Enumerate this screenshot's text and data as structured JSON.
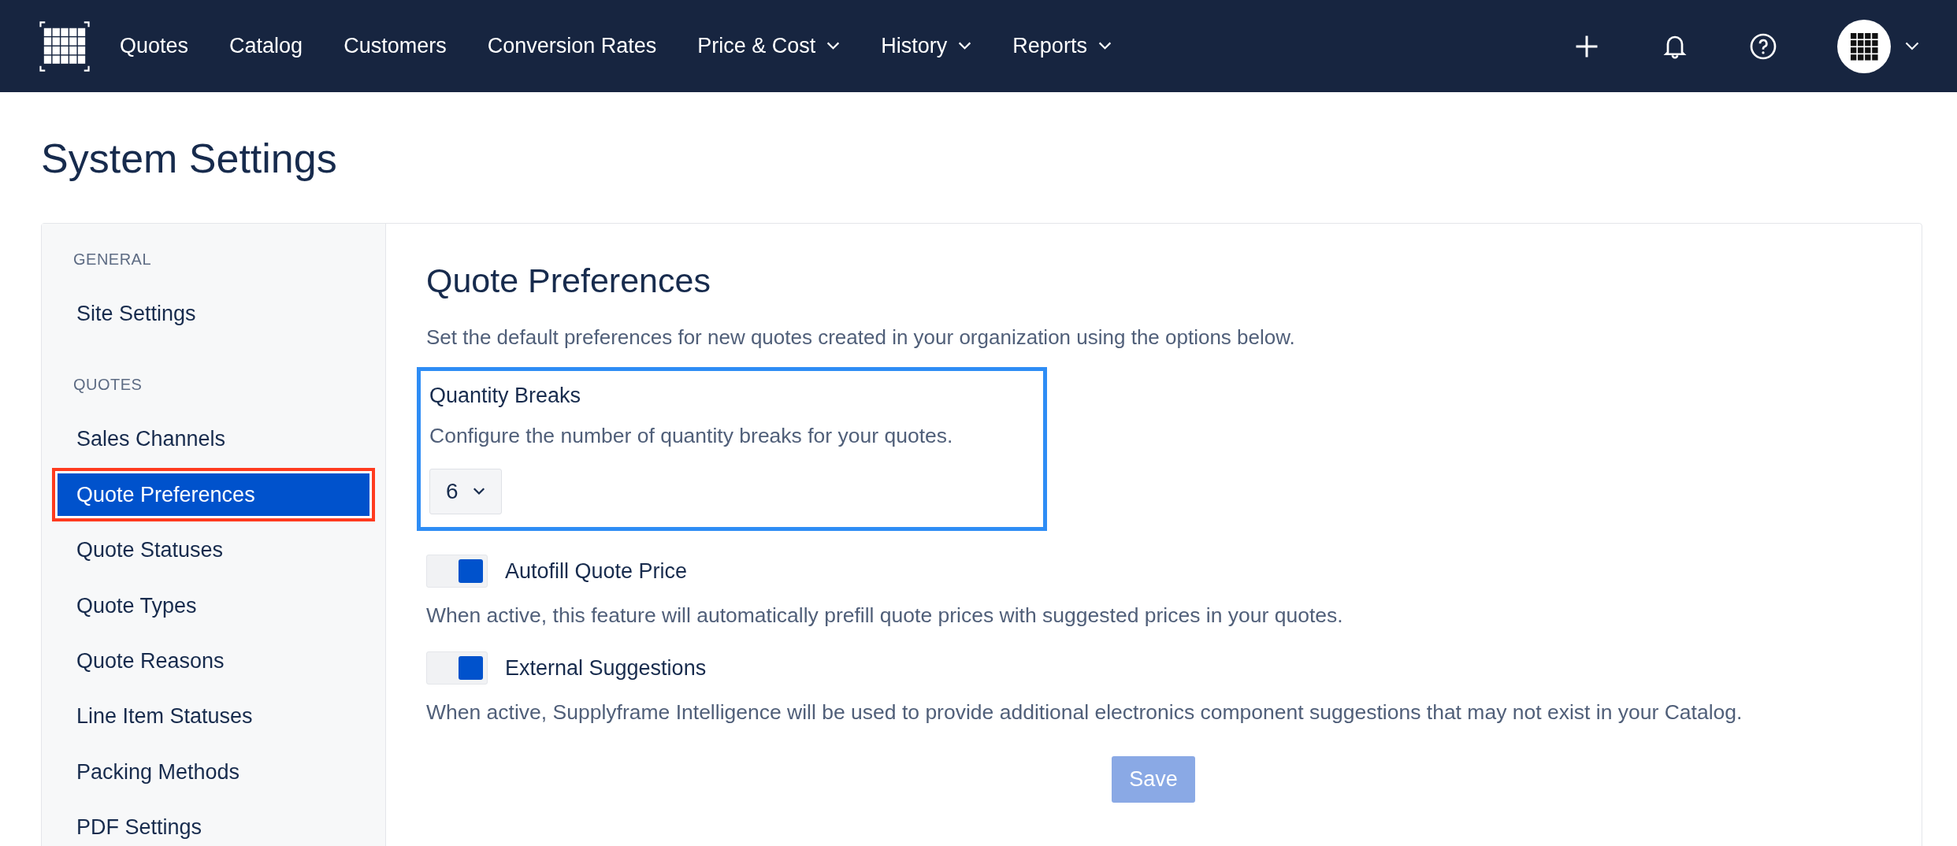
{
  "navbar": {
    "links": [
      {
        "label": "Quotes",
        "dropdown": false
      },
      {
        "label": "Catalog",
        "dropdown": false
      },
      {
        "label": "Customers",
        "dropdown": false
      },
      {
        "label": "Conversion Rates",
        "dropdown": false
      },
      {
        "label": "Price & Cost",
        "dropdown": true
      },
      {
        "label": "History",
        "dropdown": true
      },
      {
        "label": "Reports",
        "dropdown": true
      }
    ]
  },
  "page_title": "System Settings",
  "sidebar": {
    "sections": [
      {
        "heading": "GENERAL",
        "items": [
          {
            "label": "Site Settings",
            "selected": false
          }
        ]
      },
      {
        "heading": "QUOTES",
        "items": [
          {
            "label": "Sales Channels",
            "selected": false
          },
          {
            "label": "Quote Preferences",
            "selected": true
          },
          {
            "label": "Quote Statuses",
            "selected": false
          },
          {
            "label": "Quote Types",
            "selected": false
          },
          {
            "label": "Quote Reasons",
            "selected": false
          },
          {
            "label": "Line Item Statuses",
            "selected": false
          },
          {
            "label": "Packing Methods",
            "selected": false
          },
          {
            "label": "PDF Settings",
            "selected": false
          }
        ]
      }
    ]
  },
  "content": {
    "heading": "Quote Preferences",
    "description": "Set the default preferences for new quotes created in your organization using the options below.",
    "quantity_breaks": {
      "label": "Quantity Breaks",
      "description": "Configure the number of quantity breaks for your quotes.",
      "value": "6",
      "highlighted": true
    },
    "toggles": [
      {
        "label": "Autofill Quote Price",
        "on": true,
        "description": "When active, this feature will automatically prefill quote prices with suggested prices in your quotes."
      },
      {
        "label": "External Suggestions",
        "on": true,
        "description": "When active, Supplyframe Intelligence will be used to provide additional electronics component suggestions that may not exist in your Catalog."
      }
    ],
    "save": {
      "label": "Save",
      "disabled": true
    }
  }
}
